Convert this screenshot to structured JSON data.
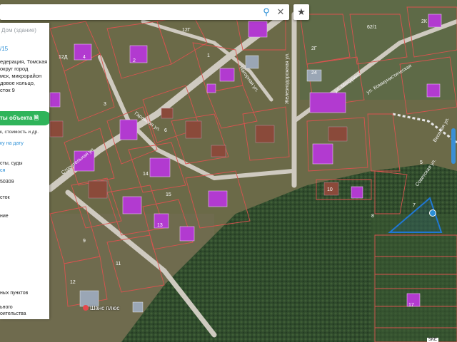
{
  "map": {
    "street_labels": [
      "Строительная ул.",
      "Железнодорожная ул.",
      "Гаражная ул.",
      "Нагорная ул.",
      "ул. Коммунистическая",
      "ул. Мичурина",
      "Советская ул.",
      "Веселая ул."
    ],
    "parcel_numbers": [
      "1",
      "2",
      "3",
      "4",
      "5",
      "6",
      "7",
      "8",
      "9",
      "10",
      "11",
      "12",
      "13",
      "14",
      "15",
      "24",
      "62/1",
      "12Г",
      "12Д",
      "2Г",
      "2К",
      "17"
    ],
    "poi_label": "Шанс плюс",
    "bottom_tag": "SKE",
    "colors": {
      "parcel_outline": "#d9534f",
      "building_highlight": "#b23ad0",
      "selected_outline": "#1f77d4",
      "road": "#d9d6cf",
      "forest": "#2c4a2a"
    }
  },
  "search": {
    "search_icon": "search-icon",
    "close_icon": "close-icon"
  },
  "favorite": {
    "icon": "star-icon",
    "label": "★"
  },
  "panel": {
    "title": "Дом (здание)",
    "number": "/15",
    "address": "едерация, Томская\nокруг город\nмск, микрорайон\nдовое кольцо,\nсток 9",
    "report_button": "ты объекта",
    "report_sub": "к, стоимость и др.",
    "date_link": "ку на дату",
    "line1": "сты, суды",
    "line2": "ся",
    "line3": "50309",
    "line4": "сток",
    "line5": "ние",
    "line6": "",
    "line7": "ных пунктов",
    "line8": "ьного",
    "line9": "оительства"
  }
}
